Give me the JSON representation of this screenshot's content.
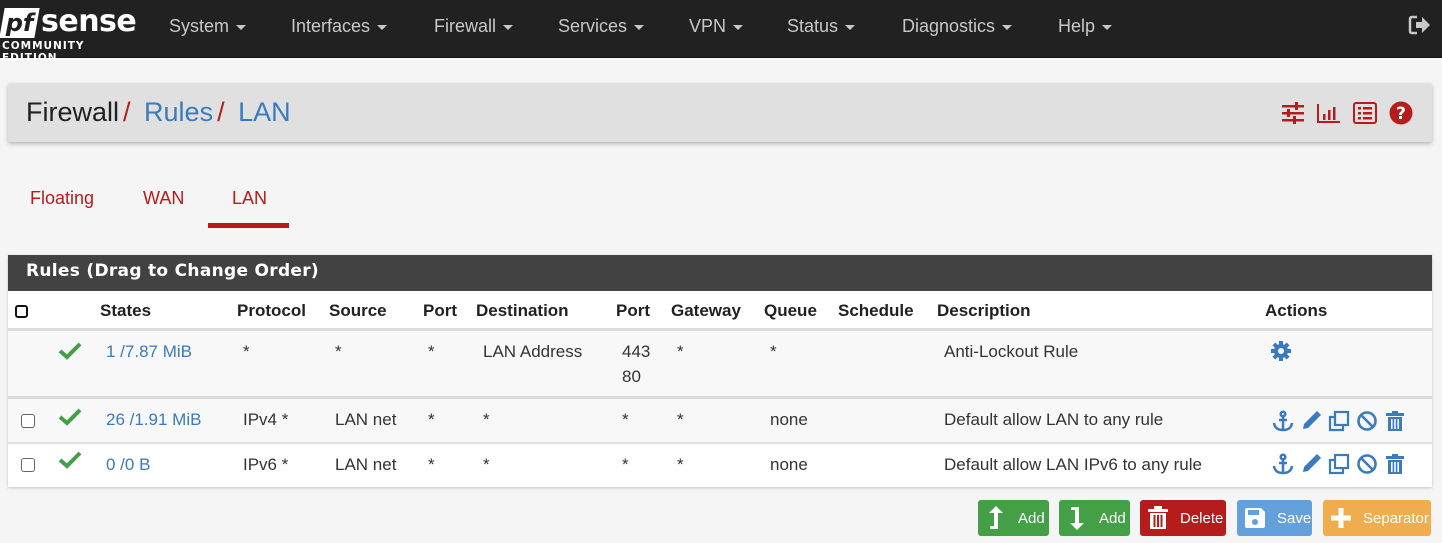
{
  "navbar": {
    "brand_pf": "pf",
    "brand_sense": "sense",
    "brand_edition": "COMMUNITY EDITION",
    "menu": [
      {
        "label": "System"
      },
      {
        "label": "Interfaces"
      },
      {
        "label": "Firewall"
      },
      {
        "label": "Services"
      },
      {
        "label": "VPN"
      },
      {
        "label": "Status"
      },
      {
        "label": "Diagnostics"
      },
      {
        "label": "Help"
      }
    ],
    "logout_icon": "sign-out-icon"
  },
  "breadcrumb": {
    "items": [
      "Firewall",
      "Rules",
      "LAN"
    ],
    "separator": "/",
    "icons": [
      "sliders-icon",
      "bar-chart-icon",
      "list-alt-icon",
      "question-circle-icon"
    ]
  },
  "tabs": {
    "items": [
      {
        "label": "Floating",
        "active": false
      },
      {
        "label": "WAN",
        "active": false
      },
      {
        "label": "LAN",
        "active": true
      }
    ]
  },
  "rules_panel": {
    "title": "Rules (Drag to Change Order)",
    "columns": [
      "",
      "",
      "States",
      "Protocol",
      "Source",
      "Port",
      "Destination",
      "Port",
      "Gateway",
      "Queue",
      "Schedule",
      "Description",
      "Actions"
    ],
    "rows": [
      {
        "checkbox": false,
        "status": "pass-check-icon",
        "states": "1 /7.87 MiB",
        "protocol": "*",
        "source": "*",
        "source_port": "*",
        "destination": "LAN Address",
        "dest_port_1": "443",
        "dest_port_2": "80",
        "gateway": "*",
        "queue": "*",
        "schedule": "",
        "description": "Anti-Lockout Rule",
        "actions": [
          "cog-icon"
        ]
      },
      {
        "checkbox": true,
        "status": "pass-check-icon",
        "states": "26 /1.91 MiB",
        "protocol": "IPv4 *",
        "source": "LAN net",
        "source_port": "*",
        "destination": "*",
        "dest_port": "*",
        "gateway": "*",
        "queue": "none",
        "schedule": "",
        "description": "Default allow LAN to any rule",
        "actions": [
          "anchor-icon",
          "pencil-icon",
          "clone-icon",
          "ban-icon",
          "trash-icon"
        ]
      },
      {
        "checkbox": true,
        "status": "pass-check-icon",
        "states": "0 /0 B",
        "protocol": "IPv6 *",
        "source": "LAN net",
        "source_port": "*",
        "destination": "*",
        "dest_port": "*",
        "gateway": "*",
        "queue": "none",
        "schedule": "",
        "description": "Default allow LAN IPv6 to any rule",
        "actions": [
          "anchor-icon",
          "pencil-icon",
          "clone-icon",
          "ban-icon",
          "trash-icon"
        ]
      }
    ]
  },
  "buttons": {
    "add_top": "Add",
    "add_bottom": "Add",
    "delete": "Delete",
    "save": "Save",
    "separator": "Separator"
  },
  "colors": {
    "navbar_bg": "#212121",
    "accent_red": "#b71c1c",
    "link_blue": "#3a7abf",
    "success_green": "#43a047",
    "save_blue": "#64a1dc",
    "separator_orange": "#f0ad4e",
    "panel_heading": "#424242"
  }
}
